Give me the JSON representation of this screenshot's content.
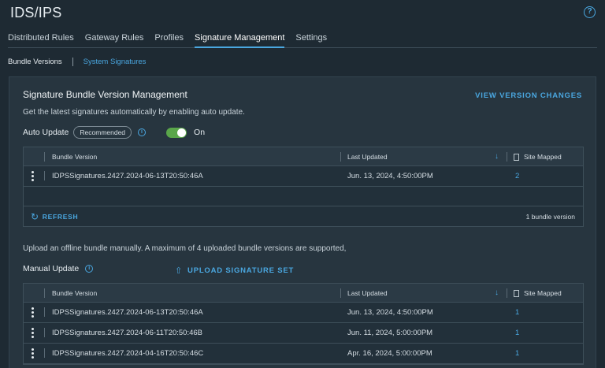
{
  "page": {
    "title": "IDS/IPS",
    "help": "?"
  },
  "tabs": [
    {
      "label": "Distributed Rules"
    },
    {
      "label": "Gateway Rules"
    },
    {
      "label": "Profiles"
    },
    {
      "label": "Signature Management"
    },
    {
      "label": "Settings"
    }
  ],
  "subtabs": {
    "bundle_versions": "Bundle Versions",
    "system_signatures": "System Signatures"
  },
  "panel": {
    "title": "Signature Bundle Version Management",
    "view_changes": "VIEW VERSION CHANGES",
    "description": "Get the latest signatures automatically by enabling auto update.",
    "auto_update": {
      "label": "Auto Update",
      "badge": "Recommended",
      "info": "i",
      "toggle_state": "On"
    },
    "auto_table": {
      "headers": {
        "bundle_version": "Bundle Version",
        "last_updated": "Last Updated",
        "sort": "↓",
        "site_mapped": "Site Mapped"
      },
      "rows": [
        {
          "bundle_version": "IDPSSignatures.2427.2024-06-13T20:50:46A",
          "last_updated": "Jun. 13, 2024, 4:50:00PM",
          "site_mapped": "2"
        }
      ],
      "refresh": "REFRESH",
      "count": "1 bundle version"
    },
    "offline_desc": "Upload an offline bundle manually. A maximum of 4 uploaded bundle versions are supported,",
    "manual_update": {
      "label": "Manual Update",
      "info": "i",
      "upload": "UPLOAD SIGNATURE SET"
    },
    "manual_table": {
      "headers": {
        "bundle_version": "Bundle Version",
        "last_updated": "Last Updated",
        "sort": "↓",
        "site_mapped": "Site Mapped"
      },
      "rows": [
        {
          "bundle_version": "IDPSSignatures.2427.2024-06-13T20:50:46A",
          "last_updated": "Jun. 13, 2024, 4:50:00PM",
          "site_mapped": "1"
        },
        {
          "bundle_version": "IDPSSignatures.2427.2024-06-11T20:50:46B",
          "last_updated": "Jun. 11, 2024, 5:00:00PM",
          "site_mapped": "1"
        },
        {
          "bundle_version": "IDPSSignatures.2427.2024-04-16T20:50:46C",
          "last_updated": "Apr. 16, 2024, 5:00:00PM",
          "site_mapped": "1"
        }
      ]
    }
  },
  "colors": {
    "accent": "#4aa7e0",
    "toggle_on": "#5aa64a",
    "background": "#1e2a33",
    "panel": "#27353f"
  }
}
